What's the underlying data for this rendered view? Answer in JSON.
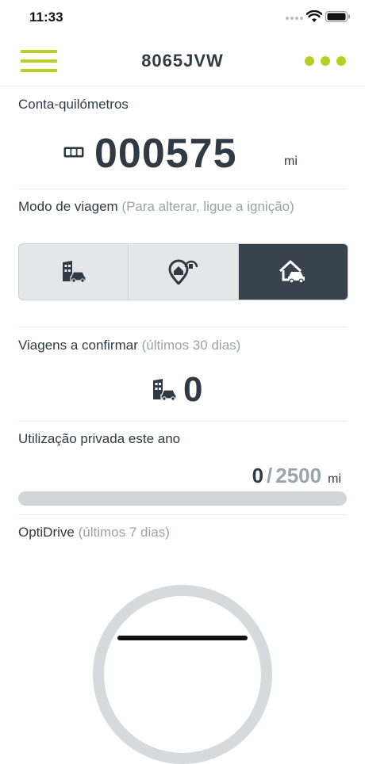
{
  "status_bar": {
    "time": "11:33"
  },
  "nav": {
    "title": "8065JVW"
  },
  "odometer": {
    "label": "Conta-quilómetros",
    "value": "000575",
    "unit": "mi",
    "icon": "odometer-icon"
  },
  "trip_mode": {
    "label": "Modo de viagem",
    "hint": "(Para alterar, ligue a ignição)",
    "options": [
      {
        "name": "business",
        "icon": "business-car-icon",
        "selected": false
      },
      {
        "name": "commute",
        "icon": "location-home-icon",
        "selected": false
      },
      {
        "name": "private",
        "icon": "home-car-icon",
        "selected": true
      }
    ]
  },
  "trips_to_confirm": {
    "label": "Viagens a confirmar",
    "hint": "(últimos 30 dias)",
    "count": "0",
    "icon": "business-car-icon"
  },
  "private_usage": {
    "label": "Utilização privada este ano",
    "used": "0",
    "separator": "/",
    "limit": "2500",
    "unit": "mi",
    "progress_fraction": 0.0
  },
  "optidrive": {
    "label": "OptiDrive",
    "hint": "(últimos 7 dias)"
  },
  "colors": {
    "accent": "#b6d026",
    "dark": "#39434d",
    "text": "#2f3a44",
    "muted": "#9aa3ab"
  }
}
